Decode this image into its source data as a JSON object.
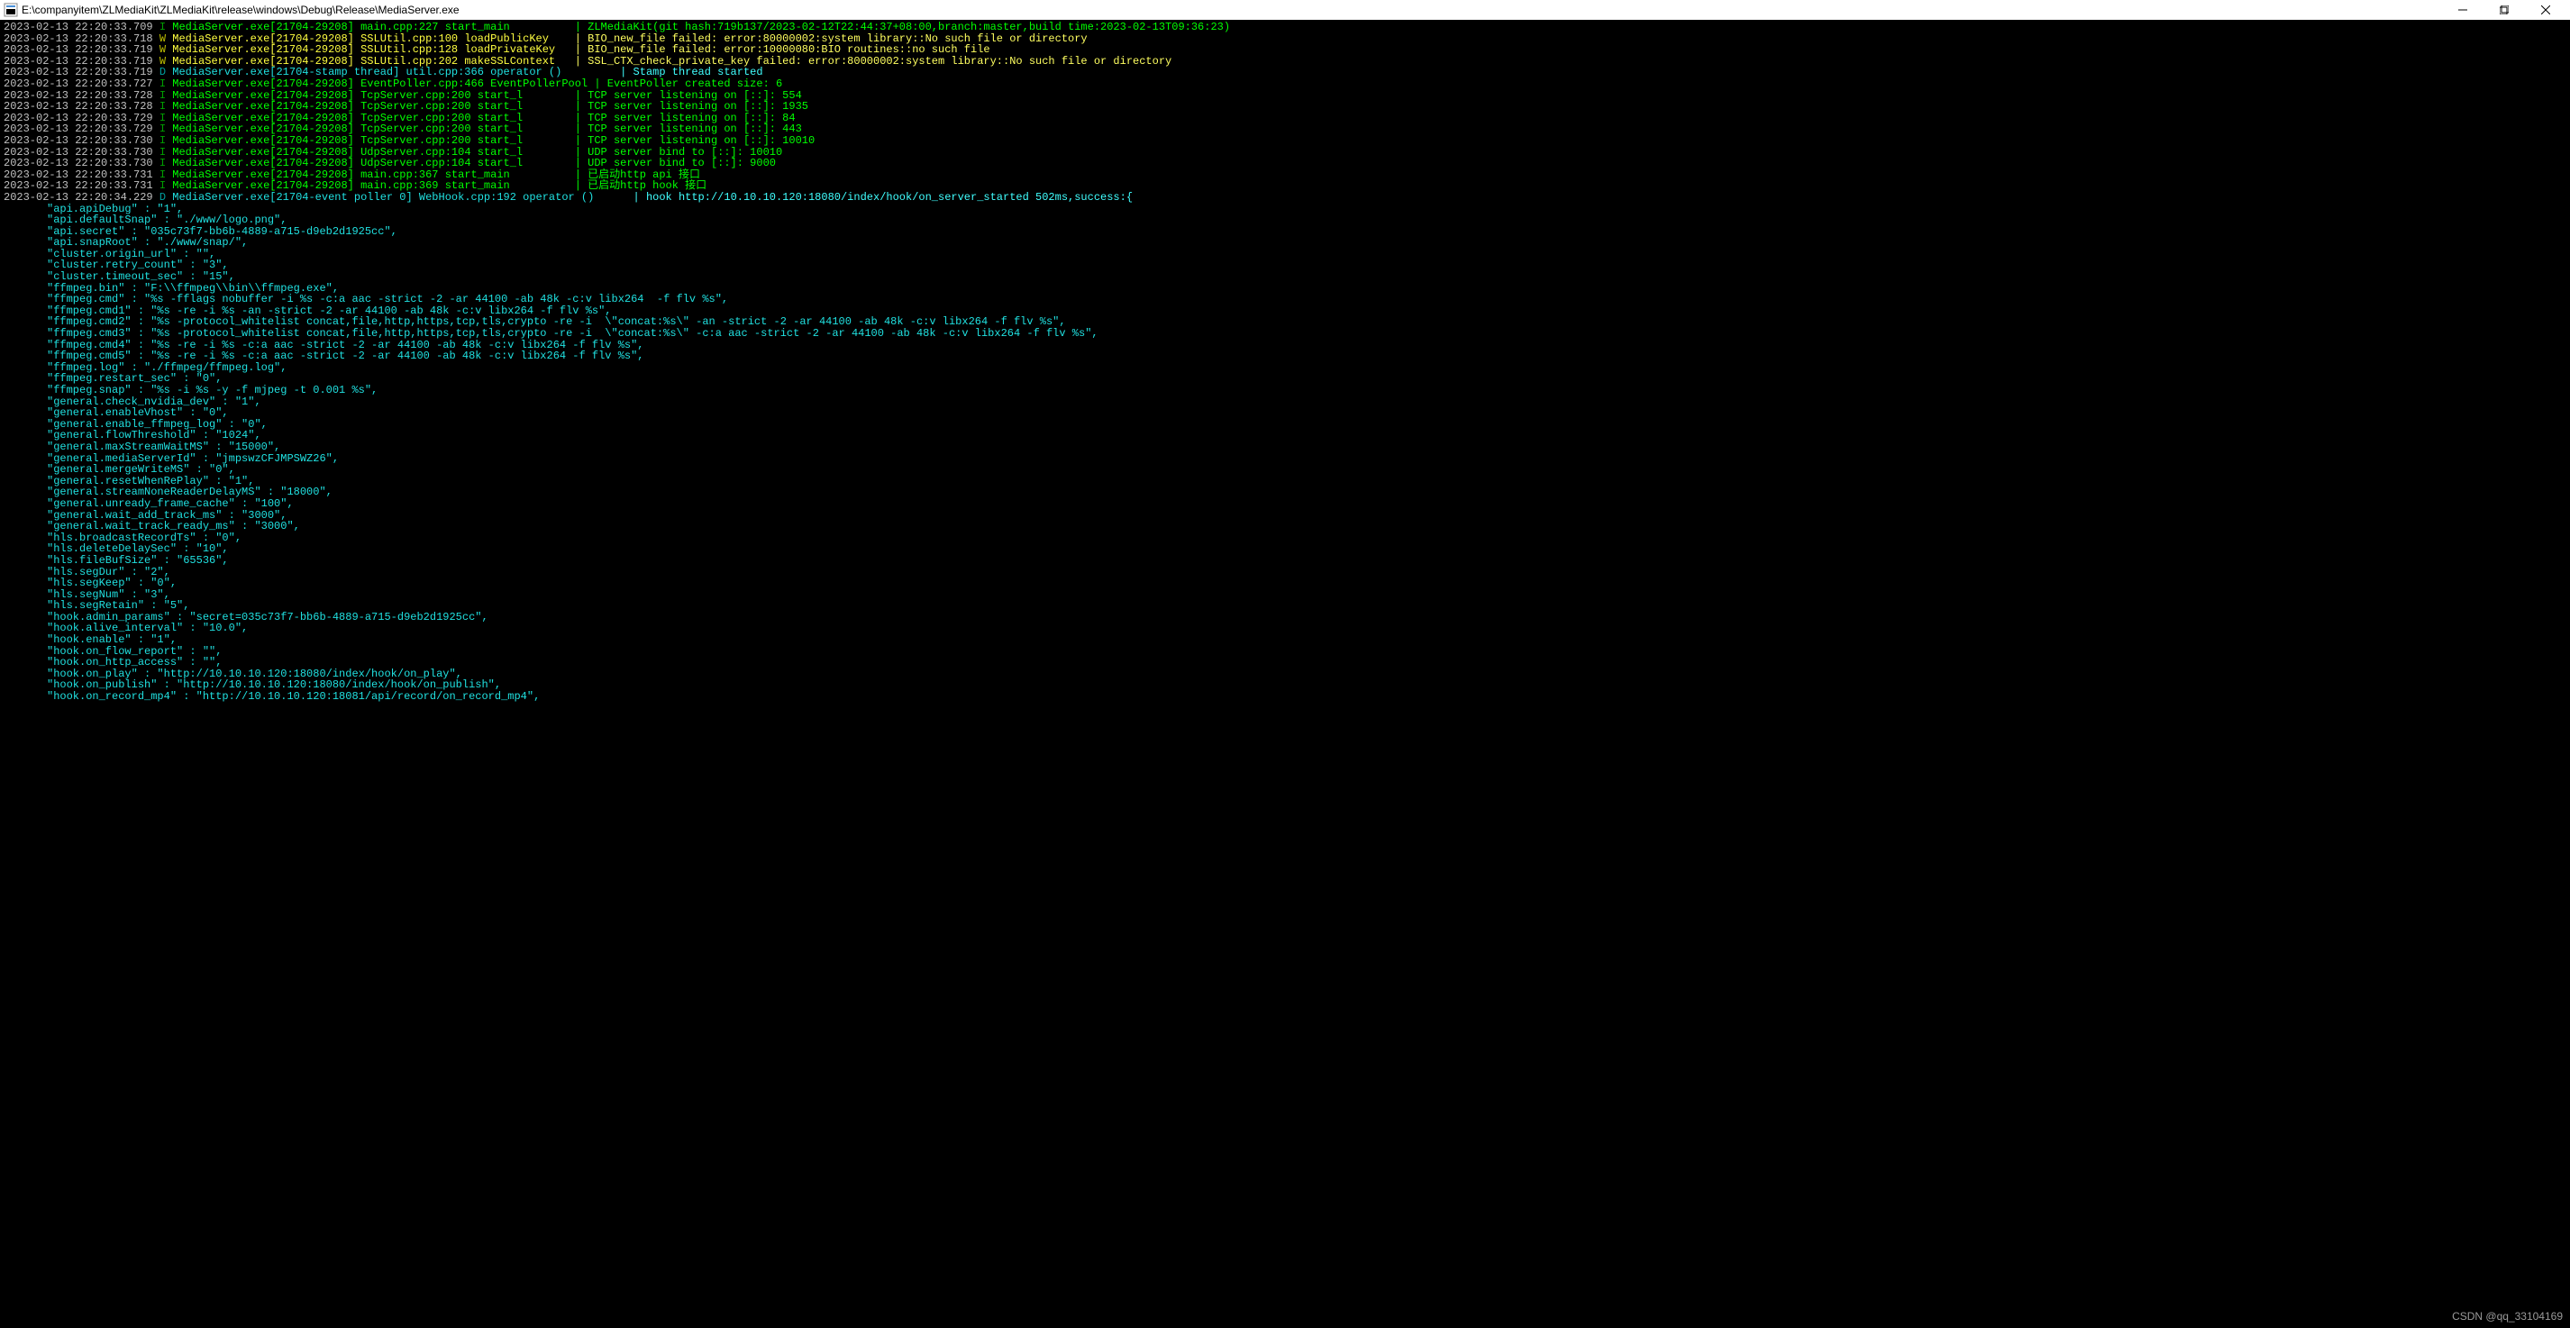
{
  "window": {
    "title": "E:\\companyitem\\ZLMediaKit\\ZLMediaKit\\release\\windows\\Debug\\Release\\MediaServer.exe"
  },
  "watermark": "CSDN @qq_33104169",
  "log": [
    {
      "ts": "2023-02-13 22:20:33.709",
      "lvl": "I",
      "proc": "MediaServer.exe[21704-29208]",
      "loc": "main.cpp:227 start_main",
      "msg": "ZLMediaKit(git hash:719b137/2023-02-12T22:44:37+08:00,branch:master,build time:2023-02-13T09:36:23)"
    },
    {
      "ts": "2023-02-13 22:20:33.718",
      "lvl": "W",
      "proc": "MediaServer.exe[21704-29208]",
      "loc": "SSLUtil.cpp:100 loadPublicKey",
      "msg": "BIO_new_file failed: error:80000002:system library::No such file or directory"
    },
    {
      "ts": "2023-02-13 22:20:33.719",
      "lvl": "W",
      "proc": "MediaServer.exe[21704-29208]",
      "loc": "SSLUtil.cpp:128 loadPrivateKey",
      "msg": "BIO_new_file failed: error:10000080:BIO routines::no such file"
    },
    {
      "ts": "2023-02-13 22:20:33.719",
      "lvl": "W",
      "proc": "MediaServer.exe[21704-29208]",
      "loc": "SSLUtil.cpp:202 makeSSLContext",
      "msg": "SSL_CTX_check_private_key failed: error:80000002:system library::No such file or directory"
    },
    {
      "ts": "2023-02-13 22:20:33.719",
      "lvl": "D",
      "proc": "MediaServer.exe[21704-stamp thread]",
      "loc": "util.cpp:366 operator ()",
      "msg": "Stamp thread started"
    },
    {
      "ts": "2023-02-13 22:20:33.727",
      "lvl": "I",
      "proc": "MediaServer.exe[21704-29208]",
      "loc": "EventPoller.cpp:466 EventPollerPool",
      "msg": "EventPoller created size: 6"
    },
    {
      "ts": "2023-02-13 22:20:33.728",
      "lvl": "I",
      "proc": "MediaServer.exe[21704-29208]",
      "loc": "TcpServer.cpp:200 start_l",
      "msg": "TCP server listening on [::]: 554"
    },
    {
      "ts": "2023-02-13 22:20:33.728",
      "lvl": "I",
      "proc": "MediaServer.exe[21704-29208]",
      "loc": "TcpServer.cpp:200 start_l",
      "msg": "TCP server listening on [::]: 1935"
    },
    {
      "ts": "2023-02-13 22:20:33.729",
      "lvl": "I",
      "proc": "MediaServer.exe[21704-29208]",
      "loc": "TcpServer.cpp:200 start_l",
      "msg": "TCP server listening on [::]: 84"
    },
    {
      "ts": "2023-02-13 22:20:33.729",
      "lvl": "I",
      "proc": "MediaServer.exe[21704-29208]",
      "loc": "TcpServer.cpp:200 start_l",
      "msg": "TCP server listening on [::]: 443"
    },
    {
      "ts": "2023-02-13 22:20:33.730",
      "lvl": "I",
      "proc": "MediaServer.exe[21704-29208]",
      "loc": "TcpServer.cpp:200 start_l",
      "msg": "TCP server listening on [::]: 10010"
    },
    {
      "ts": "2023-02-13 22:20:33.730",
      "lvl": "I",
      "proc": "MediaServer.exe[21704-29208]",
      "loc": "UdpServer.cpp:104 start_l",
      "msg": "UDP server bind to [::]: 10010"
    },
    {
      "ts": "2023-02-13 22:20:33.730",
      "lvl": "I",
      "proc": "MediaServer.exe[21704-29208]",
      "loc": "UdpServer.cpp:104 start_l",
      "msg": "UDP server bind to [::]: 9000"
    },
    {
      "ts": "2023-02-13 22:20:33.731",
      "lvl": "I",
      "proc": "MediaServer.exe[21704-29208]",
      "loc": "main.cpp:367 start_main",
      "msg": "已启动http api 接口"
    },
    {
      "ts": "2023-02-13 22:20:33.731",
      "lvl": "I",
      "proc": "MediaServer.exe[21704-29208]",
      "loc": "main.cpp:369 start_main",
      "msg": "已启动http hook 接口"
    },
    {
      "ts": "2023-02-13 22:20:34.229",
      "lvl": "D",
      "proc": "MediaServer.exe[21704-event poller 0]",
      "loc": "WebHook.cpp:192 operator ()",
      "msg": "hook http://10.10.10.120:18080/index/hook/on_server_started 502ms,success:{"
    }
  ],
  "config": [
    "\"api.apiDebug\" : \"1\",",
    "\"api.defaultSnap\" : \"./www/logo.png\",",
    "\"api.secret\" : \"035c73f7-bb6b-4889-a715-d9eb2d1925cc\",",
    "\"api.snapRoot\" : \"./www/snap/\",",
    "\"cluster.origin_url\" : \"\",",
    "\"cluster.retry_count\" : \"3\",",
    "\"cluster.timeout_sec\" : \"15\",",
    "\"ffmpeg.bin\" : \"F:\\\\ffmpeg\\\\bin\\\\ffmpeg.exe\",",
    "\"ffmpeg.cmd\" : \"%s -fflags nobuffer -i %s -c:a aac -strict -2 -ar 44100 -ab 48k -c:v libx264  -f flv %s\",",
    "\"ffmpeg.cmd1\" : \"%s -re -i %s -an -strict -2 -ar 44100 -ab 48k -c:v libx264 -f flv %s\",",
    "\"ffmpeg.cmd2\" : \"%s -protocol_whitelist concat,file,http,https,tcp,tls,crypto -re -i  \\\"concat:%s\\\" -an -strict -2 -ar 44100 -ab 48k -c:v libx264 -f flv %s\",",
    "\"ffmpeg.cmd3\" : \"%s -protocol_whitelist concat,file,http,https,tcp,tls,crypto -re -i  \\\"concat:%s\\\" -c:a aac -strict -2 -ar 44100 -ab 48k -c:v libx264 -f flv %s\",",
    "\"ffmpeg.cmd4\" : \"%s -re -i %s -c:a aac -strict -2 -ar 44100 -ab 48k -c:v libx264 -f flv %s\",",
    "\"ffmpeg.cmd5\" : \"%s -re -i %s -c:a aac -strict -2 -ar 44100 -ab 48k -c:v libx264 -f flv %s\",",
    "\"ffmpeg.log\" : \"./ffmpeg/ffmpeg.log\",",
    "\"ffmpeg.restart_sec\" : \"0\",",
    "\"ffmpeg.snap\" : \"%s -i %s -y -f mjpeg -t 0.001 %s\",",
    "\"general.check_nvidia_dev\" : \"1\",",
    "\"general.enableVhost\" : \"0\",",
    "\"general.enable_ffmpeg_log\" : \"0\",",
    "\"general.flowThreshold\" : \"1024\",",
    "\"general.maxStreamWaitMS\" : \"15000\",",
    "\"general.mediaServerId\" : \"jmpswzCFJMPSWZ26\",",
    "\"general.mergeWriteMS\" : \"0\",",
    "\"general.resetWhenRePlay\" : \"1\",",
    "\"general.streamNoneReaderDelayMS\" : \"18000\",",
    "\"general.unready_frame_cache\" : \"100\",",
    "\"general.wait_add_track_ms\" : \"3000\",",
    "\"general.wait_track_ready_ms\" : \"3000\",",
    "\"hls.broadcastRecordTs\" : \"0\",",
    "\"hls.deleteDelaySec\" : \"10\",",
    "\"hls.fileBufSize\" : \"65536\",",
    "\"hls.segDur\" : \"2\",",
    "\"hls.segKeep\" : \"0\",",
    "\"hls.segNum\" : \"3\",",
    "\"hls.segRetain\" : \"5\",",
    "\"hook.admin_params\" : \"secret=035c73f7-bb6b-4889-a715-d9eb2d1925cc\",",
    "\"hook.alive_interval\" : \"10.0\",",
    "\"hook.enable\" : \"1\",",
    "\"hook.on_flow_report\" : \"\",",
    "\"hook.on_http_access\" : \"\",",
    "\"hook.on_play\" : \"http://10.10.10.120:18080/index/hook/on_play\",",
    "\"hook.on_publish\" : \"http://10.10.10.120:18080/index/hook/on_publish\",",
    "\"hook.on_record_mp4\" : \"http://10.10.10.120:18081/api/record/on_record_mp4\","
  ]
}
